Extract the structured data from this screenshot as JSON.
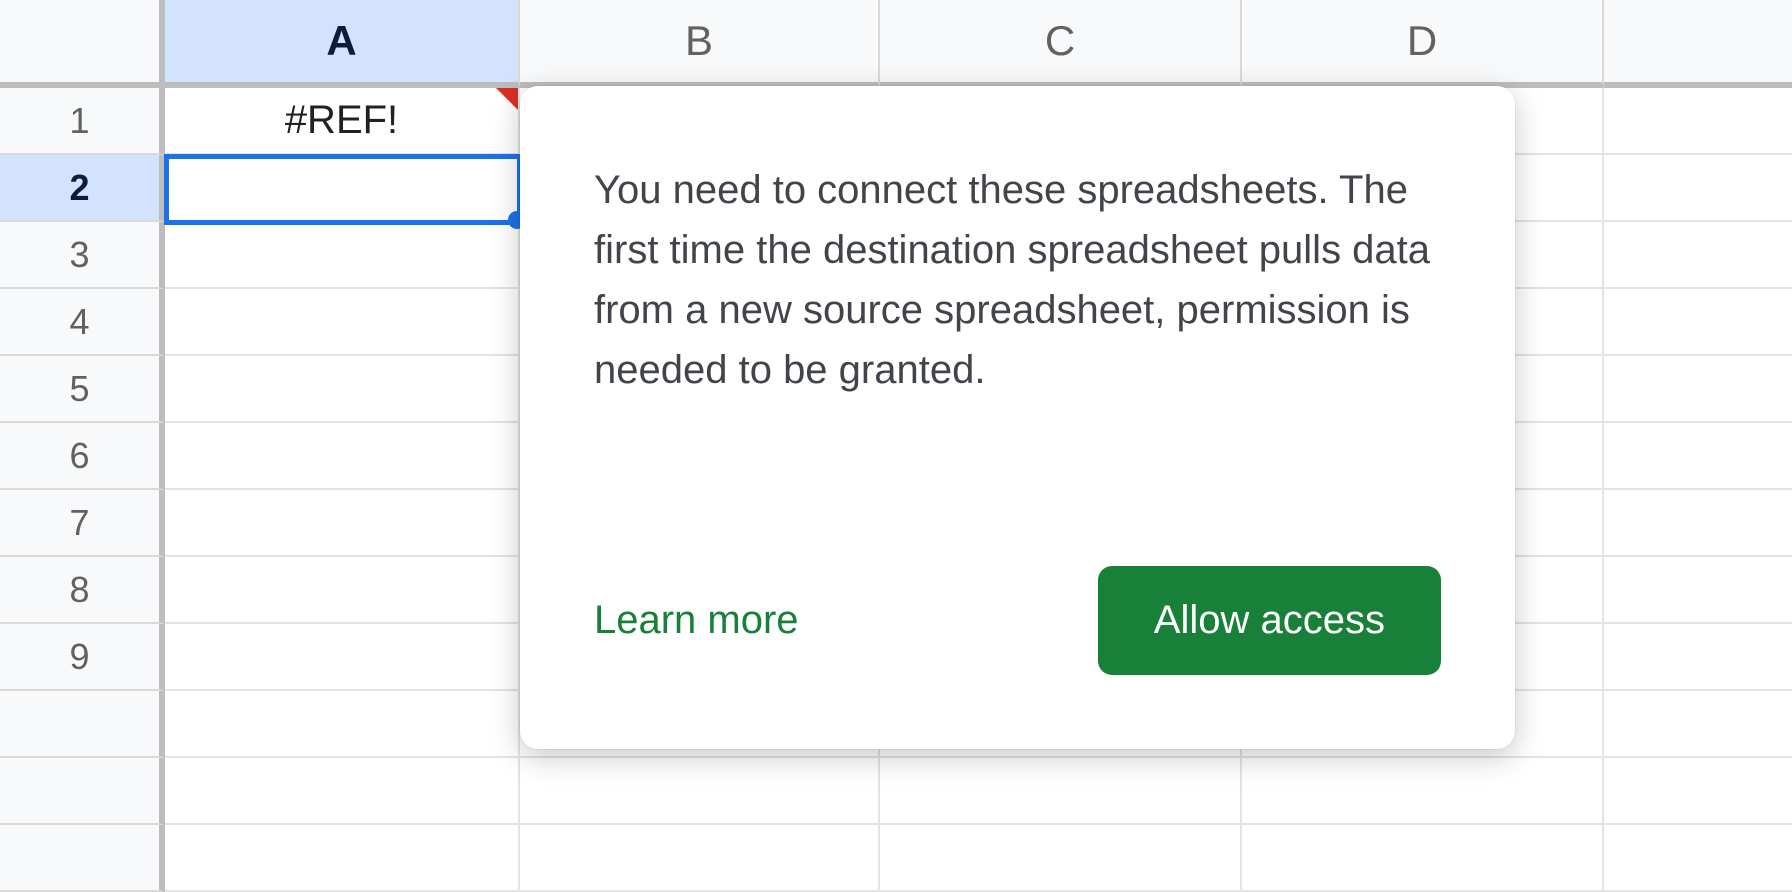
{
  "columns": [
    "A",
    "B",
    "C",
    "D"
  ],
  "rows": [
    "1",
    "2",
    "3",
    "4",
    "5",
    "6",
    "7",
    "8",
    "9"
  ],
  "active_column_index": 0,
  "active_row_index": 1,
  "cells": {
    "A1": "#REF!"
  },
  "popover": {
    "message": "You need to connect these spreadsheets. The first time the destination spreadsheet pulls data from a new source spreadsheet, permission is needed to be granted.",
    "learn_more": "Learn more",
    "allow_access": "Allow access"
  }
}
